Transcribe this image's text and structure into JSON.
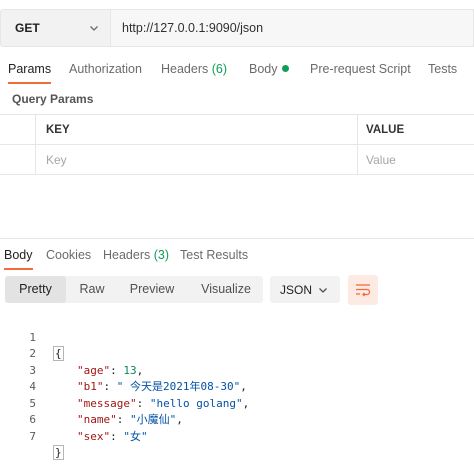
{
  "request": {
    "method": "GET",
    "url": "http://127.0.0.1:9090/json"
  },
  "request_tabs": [
    {
      "label": "Params",
      "active": true
    },
    {
      "label": "Authorization"
    },
    {
      "label": "Headers",
      "count": "(6)"
    },
    {
      "label": "Body",
      "has_dot": true
    },
    {
      "label": "Pre-request Script"
    },
    {
      "label": "Tests"
    }
  ],
  "query_params": {
    "title": "Query Params",
    "columns": {
      "key": "KEY",
      "value": "VALUE"
    },
    "placeholders": {
      "key": "Key",
      "value": "Value"
    }
  },
  "response_tabs": [
    {
      "label": "Body",
      "active": true
    },
    {
      "label": "Cookies"
    },
    {
      "label": "Headers",
      "count": "(3)"
    },
    {
      "label": "Test Results"
    }
  ],
  "view_modes": {
    "pretty": "Pretty",
    "raw": "Raw",
    "preview": "Preview",
    "visualize": "Visualize",
    "active": "Pretty"
  },
  "format": "JSON",
  "code_lines": [
    {
      "num": "1",
      "text": "{"
    },
    {
      "num": "2",
      "key": "\"age\"",
      "sep": ": ",
      "val": "13",
      "type": "n",
      "tail": ","
    },
    {
      "num": "3",
      "key": "\"b1\"",
      "sep": ": ",
      "val": "\" 今天是2021年08-30\"",
      "type": "s",
      "tail": ","
    },
    {
      "num": "4",
      "key": "\"message\"",
      "sep": ": ",
      "val": "\"hello golang\"",
      "type": "s",
      "tail": ","
    },
    {
      "num": "5",
      "key": "\"name\"",
      "sep": ": ",
      "val": "\"小魔仙\"",
      "type": "s",
      "tail": ","
    },
    {
      "num": "6",
      "key": "\"sex\"",
      "sep": ": ",
      "val": "\"女\"",
      "type": "s",
      "tail": ""
    },
    {
      "num": "7",
      "text": "}"
    }
  ],
  "colors": {
    "accent": "#f26b3a",
    "count_green": "#0f9d58",
    "json_key": "#a31515",
    "json_string": "#0451a5",
    "json_number": "#098658"
  },
  "icons": [
    "chevron-down-icon",
    "wrap-lines-icon"
  ]
}
